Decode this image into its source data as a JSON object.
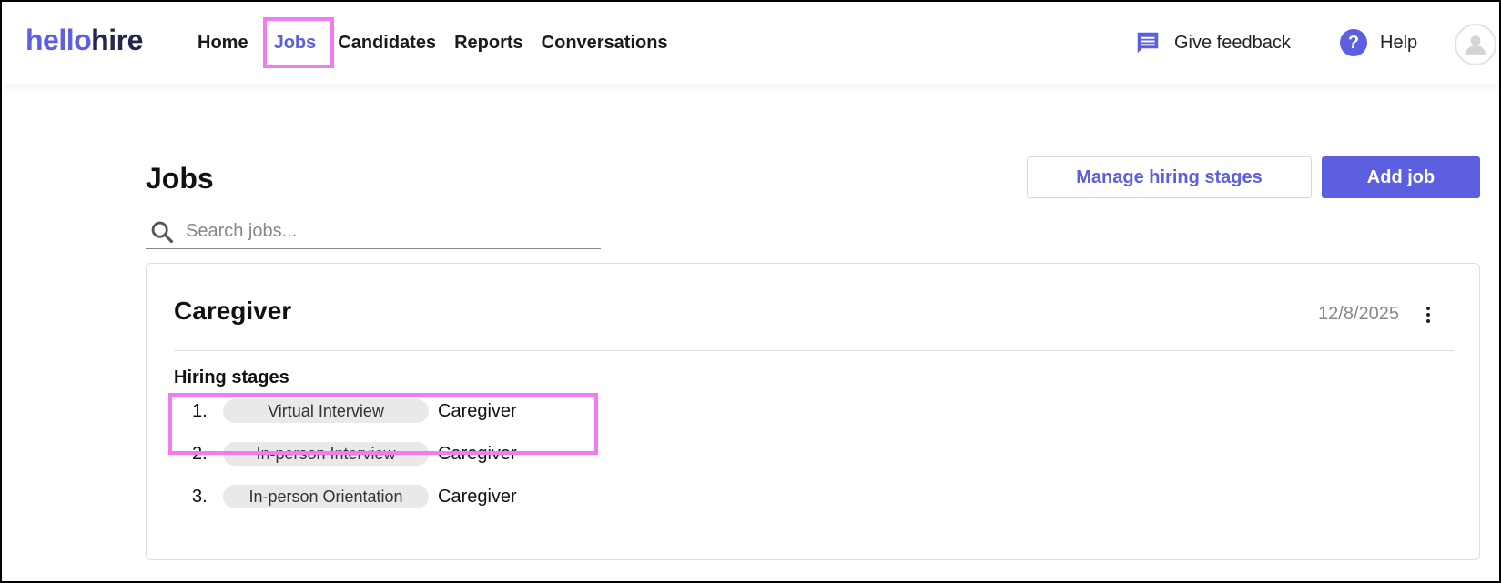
{
  "logo": {
    "part1": "hello",
    "part2": "hire"
  },
  "nav": {
    "items": [
      {
        "label": "Home"
      },
      {
        "label": "Jobs",
        "active": true
      },
      {
        "label": "Candidates"
      },
      {
        "label": "Reports"
      },
      {
        "label": "Conversations"
      }
    ]
  },
  "header": {
    "feedback_label": "Give feedback",
    "help_label": "Help",
    "feedback_icon": "chat-bubble-icon",
    "help_icon": "question-circle-icon",
    "avatar_icon": "user-icon"
  },
  "page": {
    "title": "Jobs",
    "manage_button": "Manage hiring stages",
    "add_button": "Add job"
  },
  "search": {
    "placeholder": "Search jobs..."
  },
  "job": {
    "title": "Caregiver",
    "date": "12/8/2025",
    "stages_label": "Hiring stages",
    "stages": [
      {
        "number": "1.",
        "stage": "Virtual Interview",
        "job": "Caregiver"
      },
      {
        "number": "2.",
        "stage": "In-person Interview",
        "job": "Caregiver"
      },
      {
        "number": "3.",
        "stage": "In-person Orientation",
        "job": "Caregiver"
      }
    ]
  },
  "colors": {
    "accent": "#5b5fe0",
    "logo_dark": "#23264f",
    "highlight": "#f27af2",
    "pill_bg": "#e9e9e9"
  }
}
